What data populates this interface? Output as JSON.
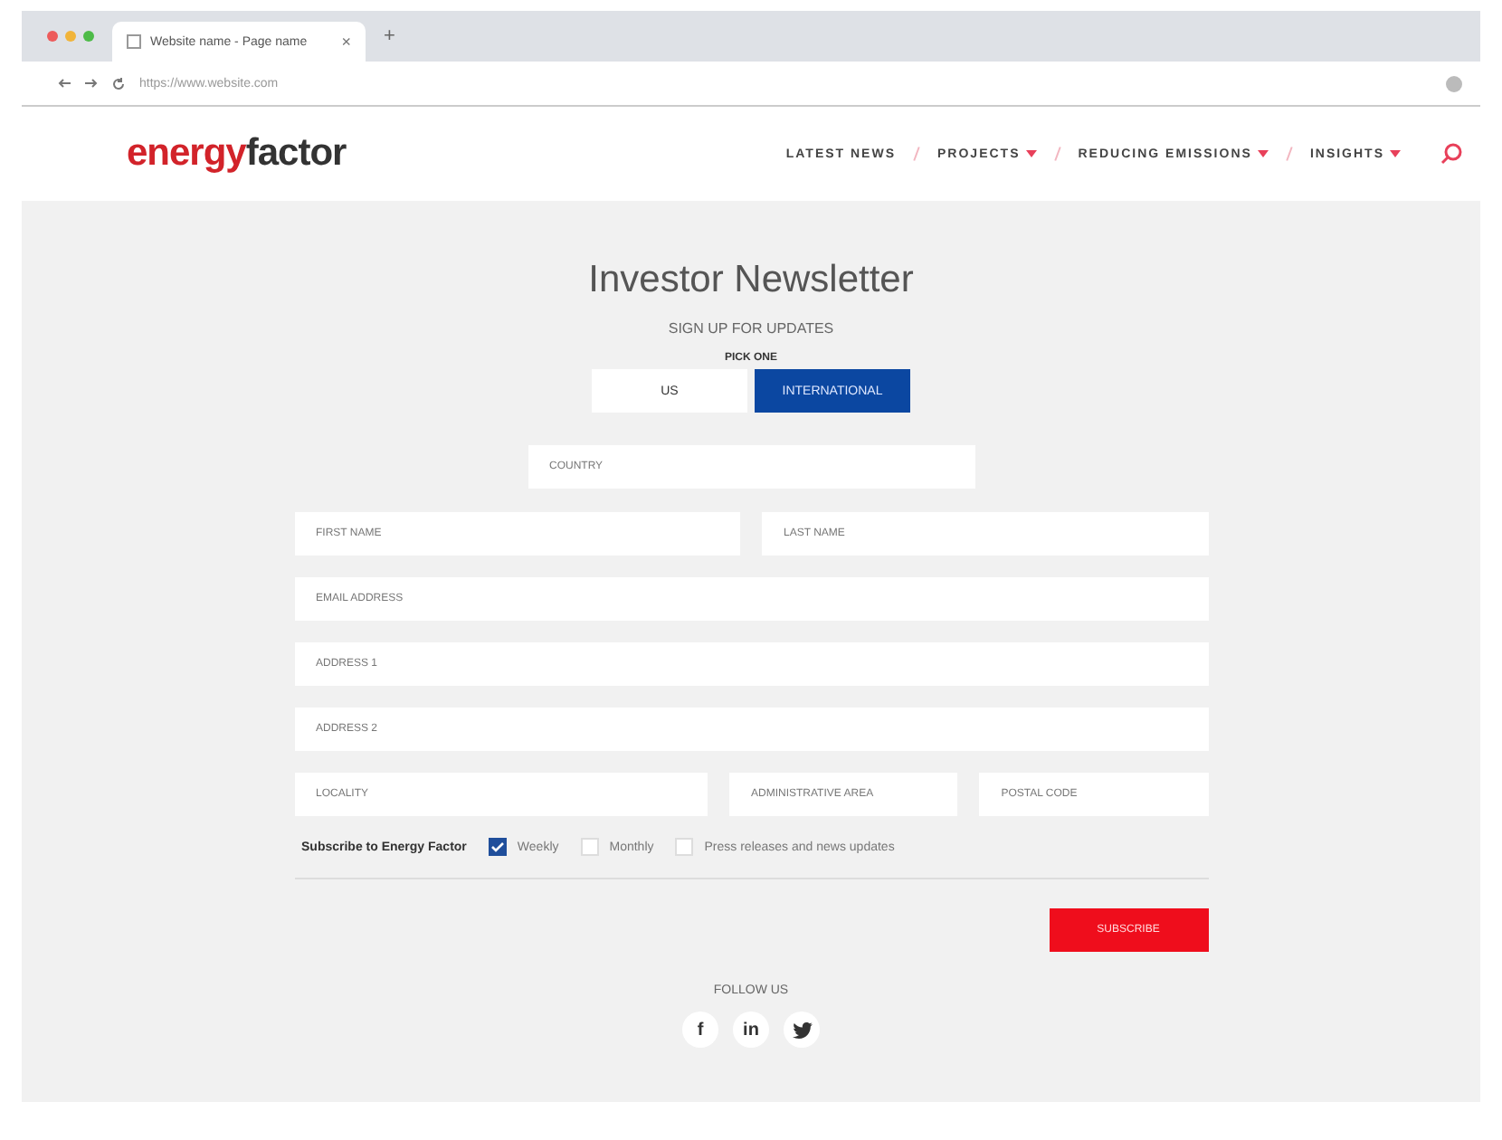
{
  "browser": {
    "tab_title": "Website name - Page name",
    "tab_close": "×",
    "new_tab": "+",
    "url": "https://www.website.com"
  },
  "logo": {
    "part_1": "energy",
    "part_2": "factor"
  },
  "nav": [
    {
      "label": "LATEST NEWS",
      "has_menu": false
    },
    {
      "label": "PROJECTS",
      "has_menu": true
    },
    {
      "label": "REDUCING EMISSIONS",
      "has_menu": true
    },
    {
      "label": "INSIGHTS",
      "has_menu": true
    }
  ],
  "title": "Investor Newsletter",
  "subtitle": "SIGN UP FOR UPDATES",
  "pick_label": "PICK ONE",
  "options": [
    {
      "label": "US",
      "selected": false
    },
    {
      "label": "INTERNATIONAL",
      "selected": true
    }
  ],
  "country": {
    "placeholder": "COUNTRY"
  },
  "rows": [
    [
      {
        "placeholder": "FIRST NAME"
      },
      {
        "placeholder": "LAST NAME"
      }
    ],
    [
      {
        "placeholder": "EMAIL ADDRESS"
      }
    ],
    [
      {
        "placeholder": "ADDRESS 1"
      }
    ],
    [
      {
        "placeholder": "ADDRESS 2"
      }
    ],
    [
      {
        "placeholder": "LOCALITY"
      },
      {
        "placeholder": "ADMINISTRATIVE AREA"
      },
      {
        "placeholder": "POSTAL CODE"
      }
    ]
  ],
  "subscribe_label": "Subscribe to Energy Factor",
  "subscriptions": [
    {
      "label": "Weekly",
      "checked": true
    },
    {
      "label": "Monthly",
      "checked": false
    },
    {
      "label": "Press releases and news updates",
      "checked": false
    }
  ],
  "submit": "SUBSCRIBE",
  "follow": "FOLLOW US",
  "social": [
    {
      "kind": "letter",
      "label": "f"
    },
    {
      "kind": "letter",
      "label": "in"
    },
    {
      "kind": "bird"
    }
  ]
}
